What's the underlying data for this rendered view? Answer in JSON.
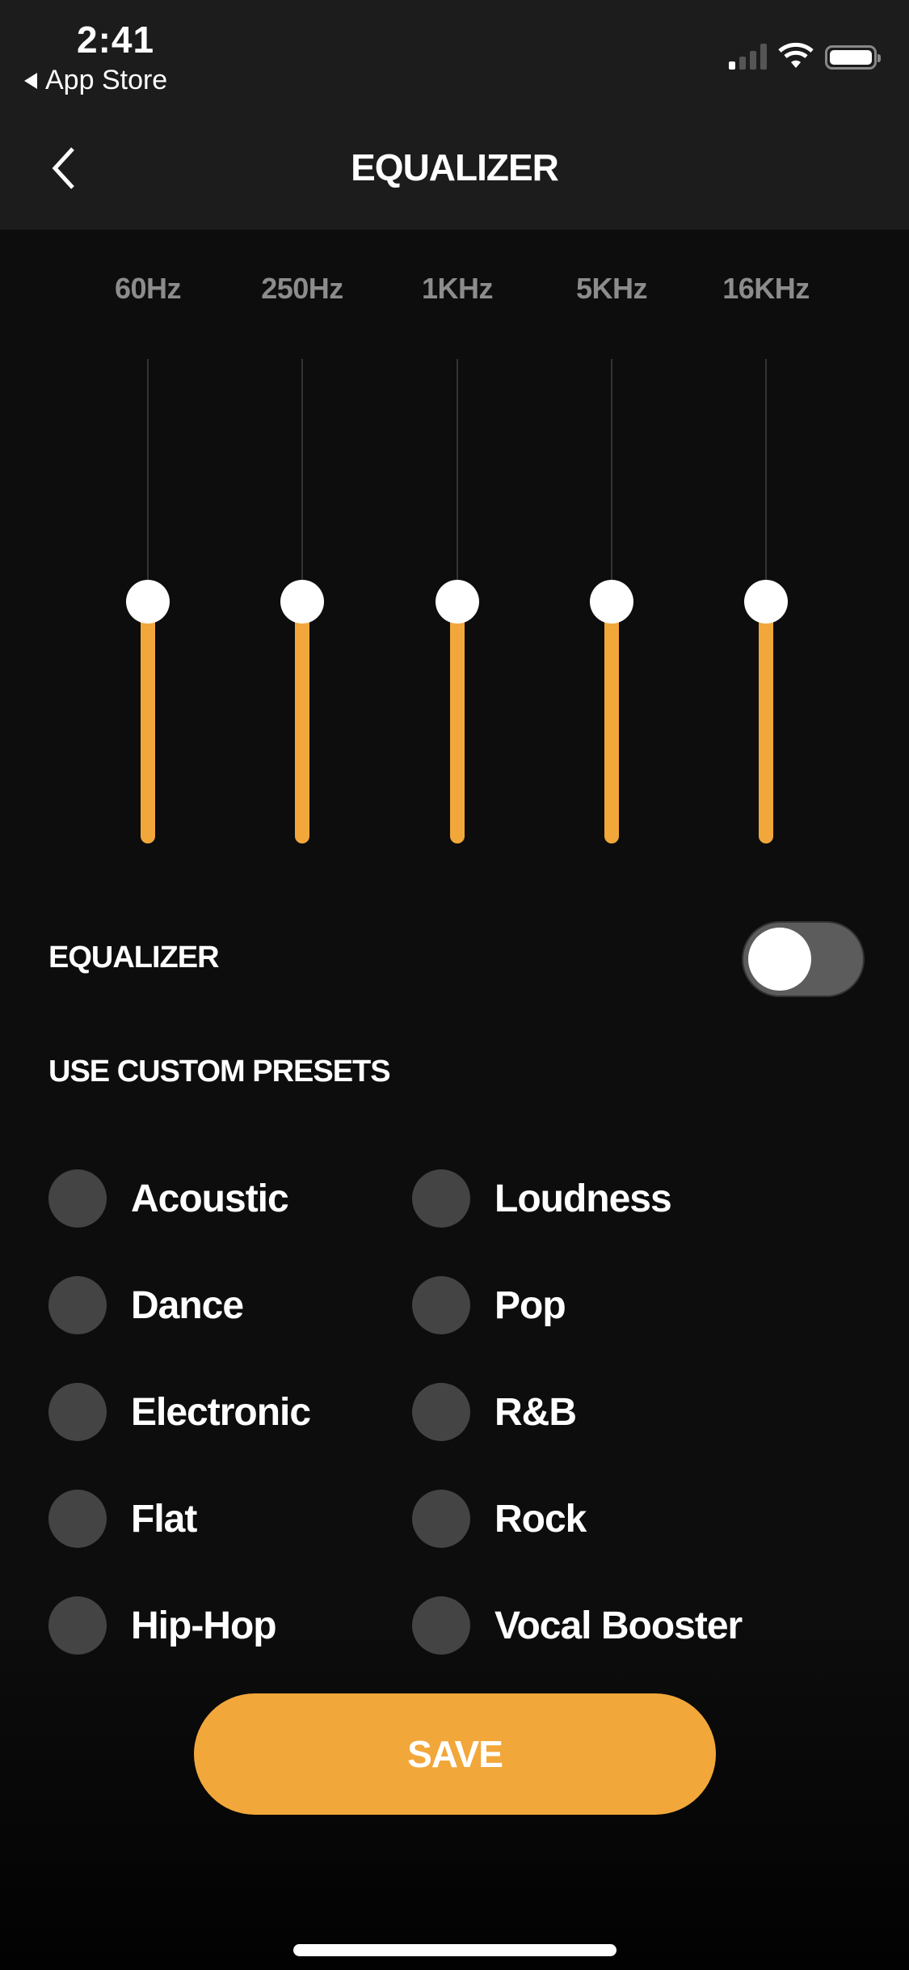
{
  "status_bar": {
    "time": "2:41",
    "back_app": "App Store",
    "signal_bars_on": 1,
    "signal_bars_total": 4,
    "battery_level": 1.0
  },
  "nav": {
    "title": "EQUALIZER",
    "back_icon": "chevron-left-icon"
  },
  "equalizer": {
    "bands": [
      {
        "label": "60Hz",
        "value": 0.5
      },
      {
        "label": "250Hz",
        "value": 0.5
      },
      {
        "label": "1KHz",
        "value": 0.5
      },
      {
        "label": "5KHz",
        "value": 0.5
      },
      {
        "label": "16KHz",
        "value": 0.5
      }
    ],
    "accent_color": "#f2a73b"
  },
  "toggle": {
    "label": "EQUALIZER",
    "on": false
  },
  "presets": {
    "heading": "USE CUSTOM PRESETS",
    "left": [
      "Acoustic",
      "Dance",
      "Electronic",
      "Flat",
      "Hip-Hop"
    ],
    "right": [
      "Loudness",
      "Pop",
      "R&B",
      "Rock",
      "Vocal Booster"
    ]
  },
  "save_label": "SAVE"
}
